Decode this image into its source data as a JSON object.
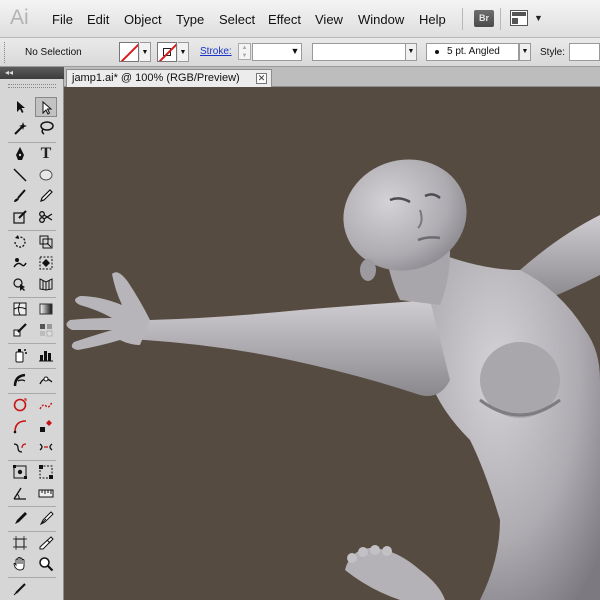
{
  "app": {
    "logo": "Ai"
  },
  "menu": {
    "items": [
      "File",
      "Edit",
      "Object",
      "Type",
      "Select",
      "Effect",
      "View",
      "Window",
      "Help"
    ],
    "bridge_label": "Br"
  },
  "control_bar": {
    "selection_status": "No Selection",
    "stroke_label": "Stroke:",
    "brush_label": "5 pt. Angled",
    "style_label": "Style:"
  },
  "document": {
    "tab_title": "jamp1.ai* @ 100% (RGB/Preview)",
    "close_glyph": "✕"
  },
  "toolbox": {
    "collapse_glyph": "◂◂"
  },
  "colors": {
    "canvas_bg": "#564b41",
    "figure": "#aaa8ad",
    "accent_red": "#d81c1c",
    "link_blue": "#1a35c8"
  },
  "icons": [
    "selection-tool-icon",
    "direct-selection-tool-icon",
    "magic-wand-icon",
    "lasso-icon",
    "pen-tool-icon",
    "type-tool-icon",
    "line-tool-icon",
    "ellipse-tool-icon",
    "paintbrush-icon",
    "pencil-icon",
    "blob-brush-icon",
    "scissors-icon",
    "rotate-icon",
    "scale-icon",
    "warp-icon",
    "free-transform-icon",
    "shape-builder-icon",
    "perspective-grid-icon",
    "mesh-icon",
    "gradient-icon",
    "eyedropper-icon",
    "blend-icon",
    "symbol-sprayer-icon",
    "column-graph-icon",
    "artboard-icon",
    "slice-icon",
    "hand-icon",
    "zoom-icon"
  ]
}
